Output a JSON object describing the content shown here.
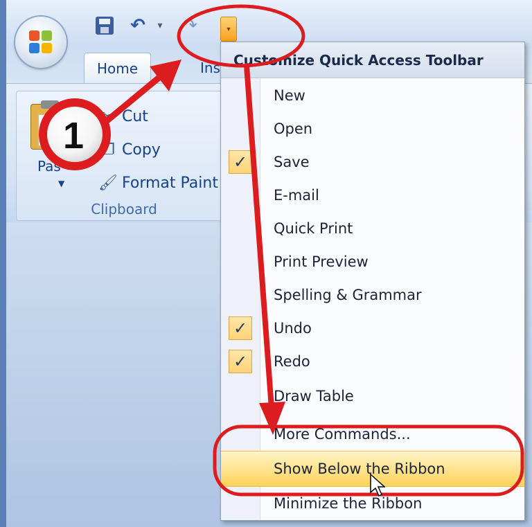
{
  "app": {
    "tabs": {
      "home": "Home",
      "insert": "Inse"
    }
  },
  "clipboard": {
    "cut": "Cut",
    "copy": "Copy",
    "format_painter": "Format Paint",
    "paste": "Pas",
    "group_label": "Clipboard"
  },
  "menu": {
    "title": "Customize Quick Access Toolbar",
    "items": [
      {
        "label": "New",
        "checked": false
      },
      {
        "label": "Open",
        "checked": false
      },
      {
        "label": "Save",
        "checked": true
      },
      {
        "label": "E-mail",
        "checked": false
      },
      {
        "label": "Quick Print",
        "checked": false
      },
      {
        "label": "Print Preview",
        "checked": false
      },
      {
        "label": "Spelling & Grammar",
        "checked": false
      },
      {
        "label": "Undo",
        "checked": true
      },
      {
        "label": "Redo",
        "checked": true
      },
      {
        "label": "Draw Table",
        "checked": false
      },
      {
        "label": "More Commands...",
        "checked": false
      },
      {
        "label": "Show Below the Ribbon",
        "checked": false,
        "highlighted": true
      },
      {
        "label": "Minimize the Ribbon",
        "checked": false
      }
    ]
  },
  "annotation": {
    "step_number": "1"
  },
  "colors": {
    "accent": "#dd1c20",
    "highlight": "#ffd35a",
    "ribbon_text": "#15428b"
  },
  "icons": {
    "office_button": "office-logo-icon",
    "save": "save-icon",
    "undo": "undo-icon",
    "redo": "redo-icon",
    "qat_dropdown": "customize-dropdown-icon",
    "cut": "scissors-icon",
    "copy": "copy-icon",
    "format_painter": "paintbrush-icon",
    "check": "checkmark-icon",
    "cursor": "mouse-pointer-icon"
  }
}
